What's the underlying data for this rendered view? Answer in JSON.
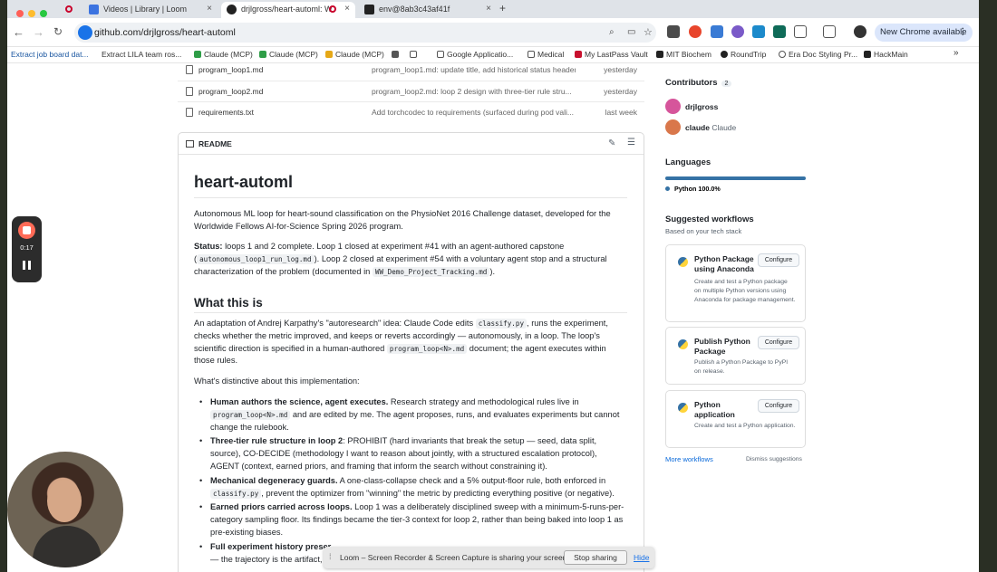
{
  "browser": {
    "tabs": [
      {
        "label": "Videos | Library | Loom"
      },
      {
        "label": "drjlgross/heart-automl: W"
      },
      {
        "label": "env@8ab3c43af41f"
      }
    ],
    "url": "github.com/drjlgross/heart-automl",
    "new_chrome": "New Chrome available",
    "add_tab": "+"
  },
  "bookmarks": [
    "Extract job board dat...",
    "Extract LILA team ros...",
    "Claude (MCP)",
    "Claude (MCP)",
    "Claude (MCP)",
    "Google Applicatio...",
    "Medical",
    "My LastPass Vault",
    "MIT Biochem",
    "RoundTrip",
    "Era Doc Styling Pr...",
    "HackMain"
  ],
  "files": [
    {
      "name": "program_loop1.md",
      "message": "program_loop1.md: update title, add historical status header",
      "date": "yesterday"
    },
    {
      "name": "program_loop2.md",
      "message": "program_loop2.md: loop 2 design with three-tier rule stru...",
      "date": "yesterday"
    },
    {
      "name": "requirements.txt",
      "message": "Add torchcodec to requirements (surfaced during pod vali...",
      "date": "last week"
    }
  ],
  "readme": {
    "label": "README",
    "title": "heart-automl",
    "intro": "Autonomous ML loop for heart-sound classification on the PhysioNet 2016 Challenge dataset, developed for the Worldwide Fellows AI-for-Science Spring 2026 program.",
    "status_label": "Status:",
    "status_1": " loops 1 and 2 complete. Loop 1 closed at experiment #41 with an agent-authored capstone (",
    "status_code_1": "autonomous_loop1_run_log.md",
    "status_2": "). Loop 2 closed at experiment #54 with a voluntary agent stop and a structural characterization of the problem (documented in ",
    "status_code_2": "WW_Demo_Project_Tracking.md",
    "status_3": ").",
    "h2": "What this is",
    "what_1": "An adaptation of Andrej Karpathy's \"autoresearch\" idea: Claude Code edits ",
    "what_code_1": "classify.py",
    "what_2": ", runs the experiment, checks whether the metric improved, and keeps or reverts accordingly — autonomously, in a loop. The loop's scientific direction is specified in a human-authored ",
    "what_code_2": "program_loop<N>.md",
    "what_3": " document; the agent executes within those rules.",
    "distinctive": "What's distinctive about this implementation:",
    "b1_bold": "Human authors the science, agent executes.",
    "b1_a": " Research strategy and methodological rules live in ",
    "b1_code": "program_loop<N>.md",
    "b1_b": " and are edited by me. The agent proposes, runs, and evaluates experiments but cannot change the rulebook.",
    "b2_bold": "Three-tier rule structure in loop 2",
    "b2_a": ": PROHIBIT (hard invariants that break the setup — seed, data split, source), CO-DECIDE (methodology I want to reason about jointly, with a structured escalation protocol), AGENT (context, earned priors, and framing that inform the search without constraining it).",
    "b3_bold": "Mechanical degeneracy guards.",
    "b3_a": " A one-class-collapse check and a 5% output-floor rule, both enforced in ",
    "b3_code": "classify.py",
    "b3_b": ", prevent the optimizer from \"winning\" the metric by predicting everything positive (or negative).",
    "b4_bold": "Earned priors carried across loops.",
    "b4_a": " Loop 1 was a deliberately disciplined sweep with a minimum-5-runs-per-category sampling floor. Its findings became the tier-3 context for loop 2, rather than being baked into loop 1 as pre-existing biases.",
    "b5_bold": "Full experiment history preser",
    "b5_a": "— the trajectory is the artifact, "
  },
  "sidebar": {
    "contributors_title": "Contributors",
    "contributors_count": "2",
    "contributors": [
      {
        "login": "drjlgross",
        "name": ""
      },
      {
        "login": "claude",
        "name": "Claude"
      }
    ],
    "languages_title": "Languages",
    "language": "Python 100.0%",
    "workflows_title": "Suggested workflows",
    "workflows_sub": "Based on your tech stack",
    "workflows": [
      {
        "name": "Python Package using Anaconda",
        "desc": "Create and test a Python package on multiple Python versions using Anaconda for package management.",
        "button": "Configure"
      },
      {
        "name": "Publish Python Package",
        "desc": "Publish a Python Package to PyPI on release.",
        "button": "Configure"
      },
      {
        "name": "Python application",
        "desc": "Create and test a Python application.",
        "button": "Configure"
      }
    ],
    "more_workflows": "More workflows",
    "dismiss": "Dismiss suggestions"
  },
  "loom": {
    "timer": "0:17",
    "sharing_text": "Loom – Screen Recorder & Screen Capture is sharing your screen.",
    "stop_sharing": "Stop sharing",
    "hide": "Hide"
  }
}
